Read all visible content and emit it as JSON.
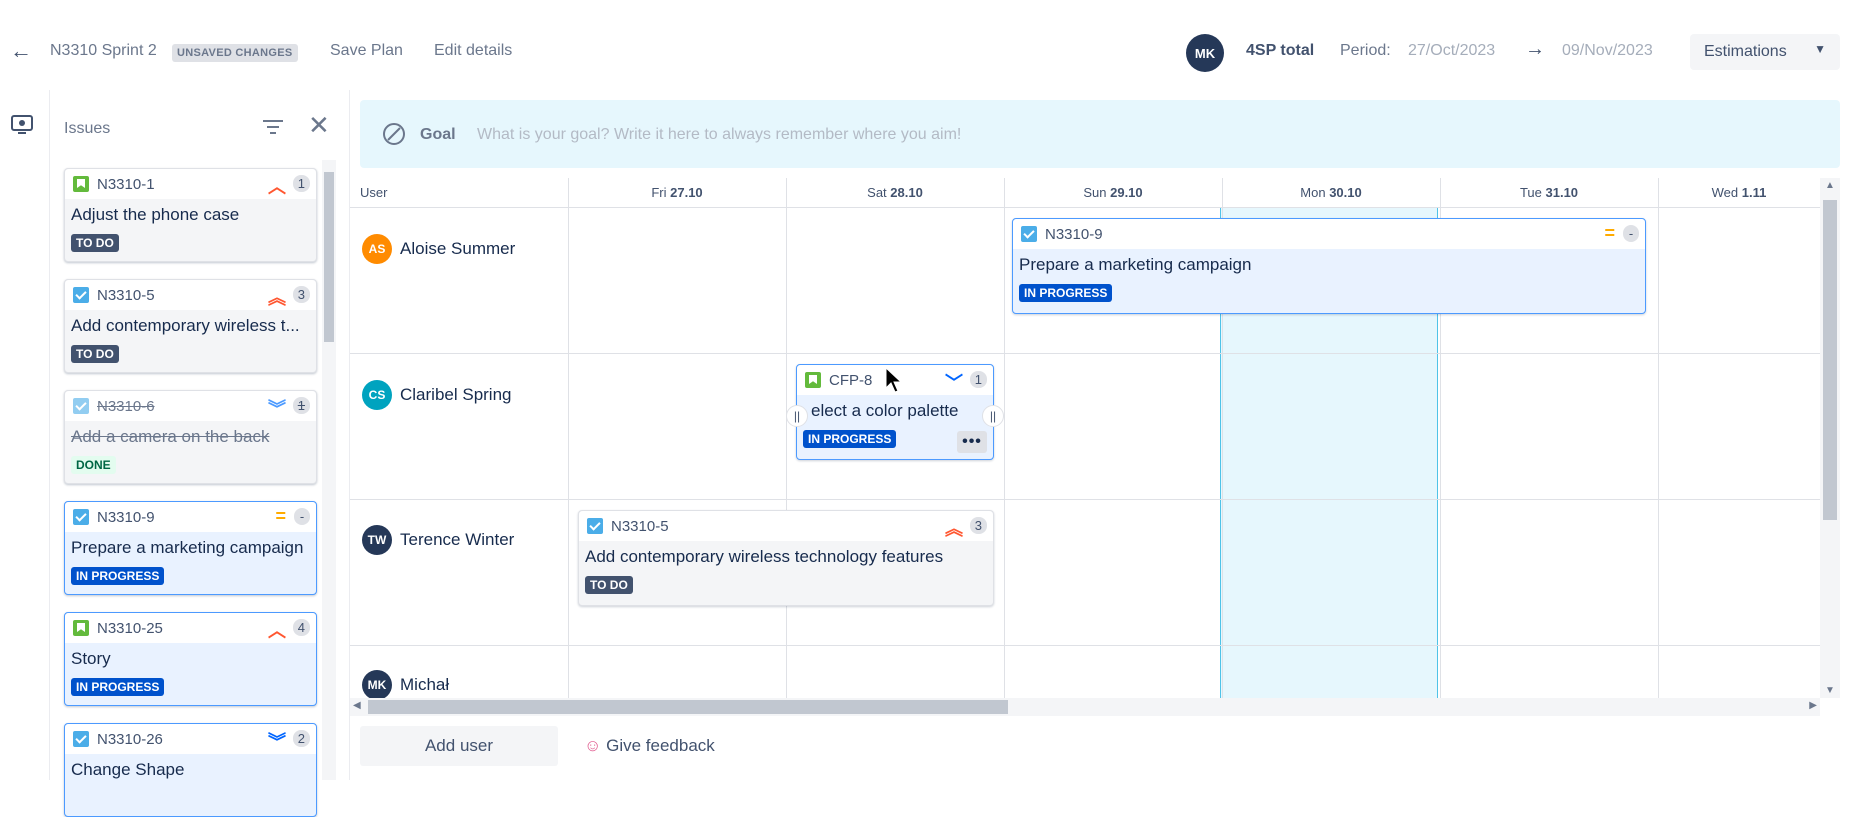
{
  "topbar": {
    "sprint_name": "N3310 Sprint 2",
    "unsaved_badge": "UNSAVED CHANGES",
    "save_plan": "Save Plan",
    "edit_details": "Edit details",
    "avatar_initials": "MK",
    "total": "4SP total",
    "period_label": "Period:",
    "period_start": "27/Oct/2023",
    "period_end": "09/Nov/2023",
    "estimations": "Estimations"
  },
  "issues_panel": {
    "title": "Issues",
    "cards": [
      {
        "key": "N3310-1",
        "title": "Adjust the phone case",
        "status": "TO DO",
        "est": "1",
        "prio": "^"
      },
      {
        "key": "N3310-5",
        "title": "Add contemporary wireless t...",
        "status": "TO DO",
        "est": "3",
        "prio": "^^"
      },
      {
        "key": "N3310-6",
        "title": "Add a camera on the back",
        "status": "DONE",
        "est": "1",
        "prio": "vv"
      },
      {
        "key": "N3310-9",
        "title": "Prepare a marketing campaign",
        "status": "IN PROGRESS",
        "est": "-",
        "prio": "="
      },
      {
        "key": "N3310-25",
        "title": "Story",
        "status": "IN PROGRESS",
        "est": "4",
        "prio": "^"
      },
      {
        "key": "N3310-26",
        "title": "Change Shape",
        "status": "",
        "est": "2",
        "prio": "vv"
      }
    ]
  },
  "goal": {
    "label": "Goal",
    "placeholder": "What is your goal? Write it here to always remember where you aim!"
  },
  "calendar": {
    "user_header": "User",
    "days": [
      {
        "dow": "Fri",
        "date": "27.10"
      },
      {
        "dow": "Sat",
        "date": "28.10"
      },
      {
        "dow": "Sun",
        "date": "29.10"
      },
      {
        "dow": "Mon",
        "date": "30.10"
      },
      {
        "dow": "Tue",
        "date": "31.10"
      },
      {
        "dow": "Wed",
        "date": "1.11"
      }
    ],
    "users": [
      {
        "initials": "AS",
        "name": "Aloise Summer",
        "color": "#ff8b00"
      },
      {
        "initials": "CS",
        "name": "Claribel Spring",
        "color": "#00a3bf"
      },
      {
        "initials": "TW",
        "name": "Terence Winter",
        "color": "#253858"
      },
      {
        "initials": "MK",
        "name": "Michał",
        "color": "#253858"
      }
    ],
    "cards": [
      {
        "key": "N3310-9",
        "title": "Prepare a marketing campaign",
        "status": "IN PROGRESS",
        "est": "-",
        "prio": "="
      },
      {
        "key": "CFP-8",
        "title": "elect a color palette",
        "status": "IN PROGRESS",
        "est": "1",
        "prio": "v"
      },
      {
        "key": "N3310-5",
        "title": "Add contemporary wireless technology features",
        "status": "TO DO",
        "est": "3",
        "prio": "^^"
      }
    ]
  },
  "footer": {
    "add_user": "Add user",
    "feedback": "Give feedback"
  },
  "colors": {
    "accent": "#0052cc",
    "highlight_col": "#e6f7fd"
  }
}
